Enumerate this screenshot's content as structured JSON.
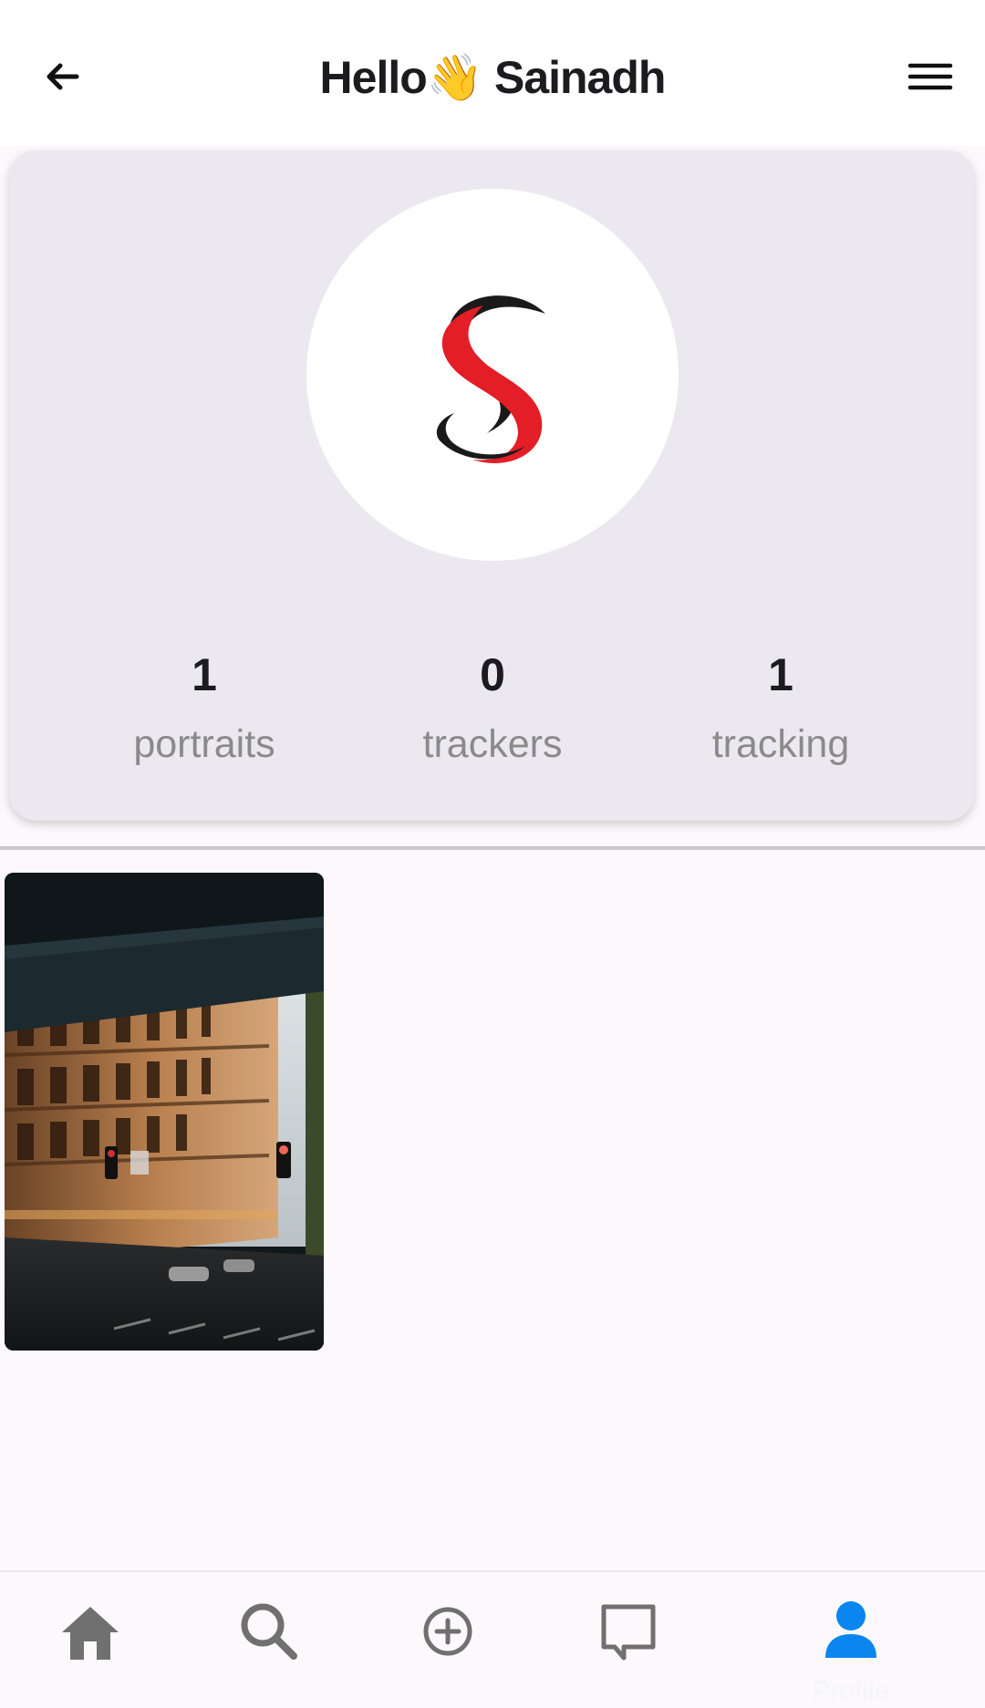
{
  "header": {
    "title_prefix": "Hello",
    "title_emoji": "👋",
    "title_name": "Sainadh"
  },
  "profile": {
    "stats": [
      {
        "value": "1",
        "label": "portraits"
      },
      {
        "value": "0",
        "label": "trackers"
      },
      {
        "value": "1",
        "label": "tracking"
      }
    ]
  },
  "grid": {
    "photos": [
      {
        "icon": "street-building-photo"
      }
    ]
  },
  "bottom_nav": {
    "items": [
      {
        "icon": "home-icon"
      },
      {
        "icon": "search-icon"
      },
      {
        "icon": "add-circle-icon"
      },
      {
        "icon": "chat-icon"
      },
      {
        "icon": "person-icon",
        "label": "Profile",
        "active": true
      }
    ]
  },
  "colors": {
    "accent": "#1a73e8",
    "active_icon": "#0a86ee",
    "inactive_icon": "#707070",
    "card_bg": "#ece8ef",
    "logo_red": "#e31e26",
    "logo_black": "#1a1a1a"
  }
}
